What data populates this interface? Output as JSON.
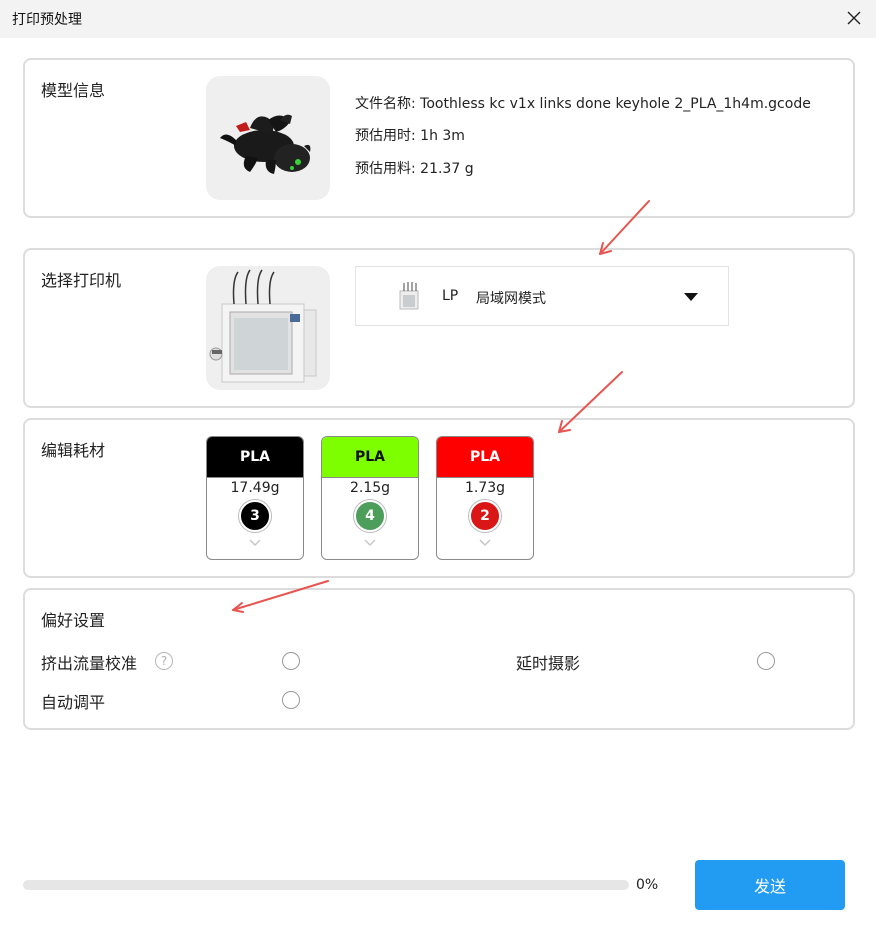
{
  "window": {
    "title": "打印预处理",
    "close_icon": "close-icon"
  },
  "model_info": {
    "label": "模型信息",
    "file_name": "文件名称: Toothless kc v1x links done keyhole 2_PLA_1h4m.gcode",
    "est_time": "预估用时: 1h 3m",
    "est_material": "预估用料: 21.37 g"
  },
  "printer": {
    "label": "选择打印机",
    "name": "LP",
    "mode": "局域网模式",
    "dropdown_icon": "caret-down-icon"
  },
  "filament": {
    "label": "编辑耗材",
    "items": [
      {
        "type": "PLA",
        "weight": "17.49g",
        "slot": "3",
        "color": "#000000",
        "text_color": "#ffffff",
        "slot_color": "#000000"
      },
      {
        "type": "PLA",
        "weight": "2.15g",
        "slot": "4",
        "color": "#7dff00",
        "text_color": "#111111",
        "slot_color": "#4d9e5a"
      },
      {
        "type": "PLA",
        "weight": "1.73g",
        "slot": "2",
        "color": "#ff0000",
        "text_color": "#ffffff",
        "slot_color": "#d91717"
      }
    ]
  },
  "preferences": {
    "label": "偏好设置",
    "flow_calibration": "挤出流量校准",
    "timelapse": "延时摄影",
    "auto_leveling": "自动调平",
    "help_icon": "?"
  },
  "progress": {
    "value": 0,
    "text": "0%"
  },
  "send_button": "发送",
  "colors": {
    "accent": "#229bf2",
    "arrow": "#e8544f",
    "border": "#dcdcdc"
  }
}
